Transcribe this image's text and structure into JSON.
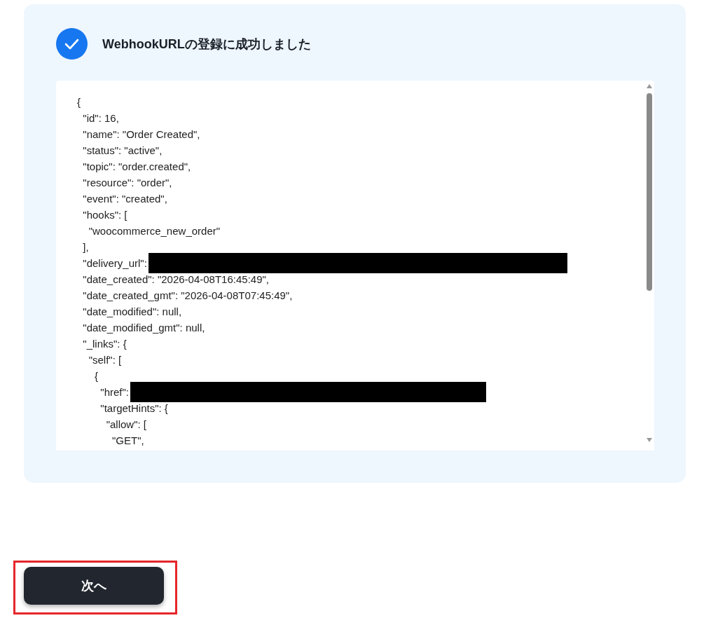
{
  "panel": {
    "title": "WebhookURLの登録に成功しました",
    "code_lines": [
      {
        "kind": "text",
        "text": "{"
      },
      {
        "kind": "text",
        "text": "  \"id\": 16,"
      },
      {
        "kind": "text",
        "text": "  \"name\": \"Order Created\","
      },
      {
        "kind": "text",
        "text": "  \"status\": \"active\","
      },
      {
        "kind": "text",
        "text": "  \"topic\": \"order.created\","
      },
      {
        "kind": "text",
        "text": "  \"resource\": \"order\","
      },
      {
        "kind": "text",
        "text": "  \"event\": \"created\","
      },
      {
        "kind": "text",
        "text": "  \"hooks\": ["
      },
      {
        "kind": "text",
        "text": "    \"woocommerce_new_order\""
      },
      {
        "kind": "text",
        "text": "  ],"
      },
      {
        "kind": "redacted",
        "text": "  \"delivery_url\":"
      },
      {
        "kind": "text",
        "text": "  \"date_created\": \"2026-04-08T16:45:49\","
      },
      {
        "kind": "text",
        "text": "  \"date_created_gmt\": \"2026-04-08T07:45:49\","
      },
      {
        "kind": "text",
        "text": "  \"date_modified\": null,"
      },
      {
        "kind": "text",
        "text": "  \"date_modified_gmt\": null,"
      },
      {
        "kind": "text",
        "text": "  \"_links\": {"
      },
      {
        "kind": "text",
        "text": "    \"self\": ["
      },
      {
        "kind": "text",
        "text": "      {"
      },
      {
        "kind": "redacted",
        "text": "        \"href\":"
      },
      {
        "kind": "text",
        "text": "        \"targetHints\": {"
      },
      {
        "kind": "text",
        "text": "          \"allow\": ["
      },
      {
        "kind": "text",
        "text": "            \"GET\","
      }
    ]
  },
  "next_button": {
    "label": "次へ",
    "highlighted": true
  }
}
